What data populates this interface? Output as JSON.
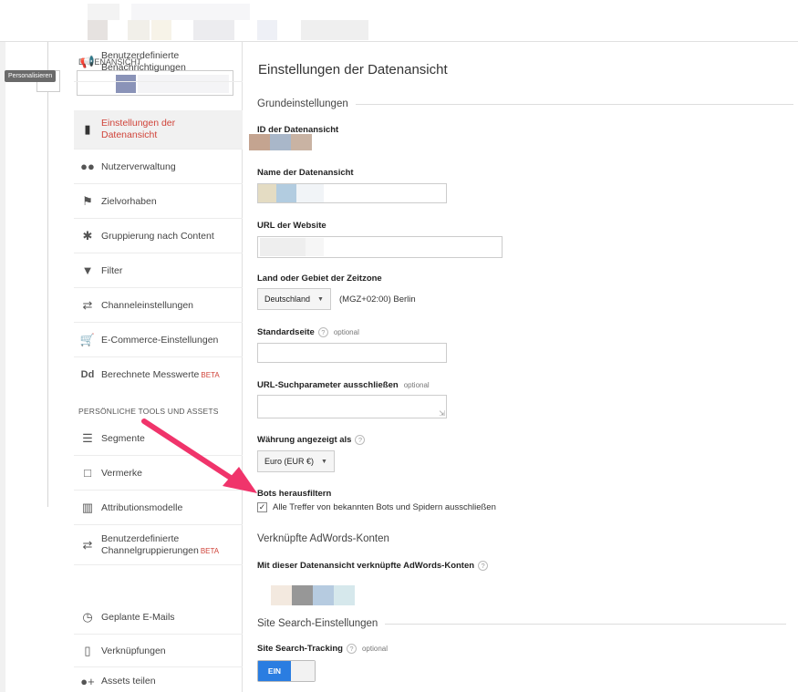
{
  "personalize_tooltip": "Personalisieren",
  "sidebar": {
    "view_label": "DATENANSICHT",
    "items": [
      {
        "label": "Einstellungen der Datenansicht",
        "icon": "document-icon",
        "active": true
      },
      {
        "label": "Nutzerverwaltung",
        "icon": "users-icon"
      },
      {
        "label": "Zielvorhaben",
        "icon": "flag-icon"
      },
      {
        "label": "Gruppierung nach Content",
        "icon": "content-grouping-icon"
      },
      {
        "label": "Filter",
        "icon": "filter-icon"
      },
      {
        "label": "Channeleinstellungen",
        "icon": "channel-icon"
      },
      {
        "label": "E-Commerce-Einstellungen",
        "icon": "cart-icon"
      },
      {
        "label": "Berechnete Messwerte",
        "icon": "dd-icon",
        "badge": "BETA"
      }
    ],
    "tools_header": "PERSÖNLICHE TOOLS UND ASSETS",
    "tools": [
      {
        "label": "Segmente",
        "icon": "segments-icon"
      },
      {
        "label": "Vermerke",
        "icon": "comment-icon"
      },
      {
        "label": "Attributionsmodelle",
        "icon": "bar-chart-icon"
      },
      {
        "label": "Benutzerdefinierte Channelgruppierungen",
        "icon": "channel-icon",
        "badge": "BETA"
      },
      {
        "label": "Benutzerdefinierte Benachrichtigungen",
        "icon": "megaphone-icon"
      },
      {
        "label": "Geplante E-Mails",
        "icon": "alarm-icon"
      },
      {
        "label": "Verknüpfungen",
        "icon": "shortcut-icon"
      },
      {
        "label": "Assets teilen",
        "icon": "share-users-icon"
      }
    ]
  },
  "main": {
    "title": "Einstellungen der Datenansicht",
    "section_basic": "Grundeinstellungen",
    "view_id_label": "ID der Datenansicht",
    "view_name_label": "Name der Datenansicht",
    "website_url_label": "URL der Website",
    "timezone_label": "Land oder Gebiet der Zeitzone",
    "timezone_country": "Deutschland",
    "timezone_value": "(MGZ+02:00) Berlin",
    "default_page_label": "Standardseite",
    "optional": "optional",
    "exclude_params_label": "URL-Suchparameter ausschließen",
    "currency_label": "Währung angezeigt als",
    "currency_value": "Euro (EUR €)",
    "bots_label": "Bots herausfiltern",
    "bots_checkbox_label": "Alle Treffer von bekannten Bots und Spidern ausschließen",
    "bots_checked": true,
    "section_adwords": "Verknüpfte AdWords-Konten",
    "adwords_linked_label": "Mit dieser Datenansicht verknüpfte AdWords-Konten",
    "section_site_search": "Site Search-Einstellungen",
    "site_search_label": "Site Search-Tracking",
    "toggle_label": "EIN",
    "toggle_on": true
  },
  "colors": {
    "active_nav": "#d0443a",
    "accent_blue": "#2a7de1",
    "arrow": "#f0346b"
  }
}
